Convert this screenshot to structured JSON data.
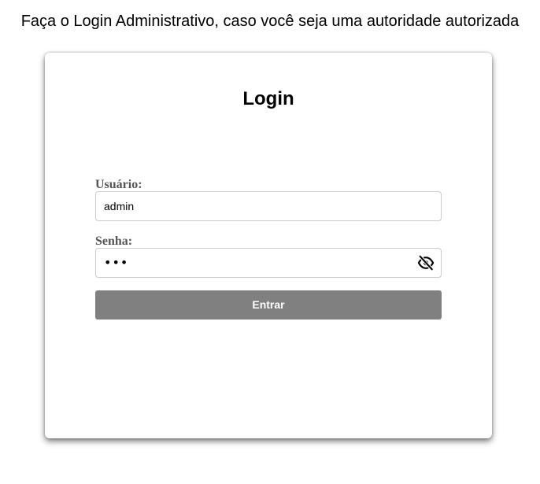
{
  "header": {
    "heading": "Faça o Login Administrativo, caso você seja uma autoridade autorizada"
  },
  "login_card": {
    "title": "Login",
    "username": {
      "label": "Usuário:",
      "value": "admin"
    },
    "password": {
      "label": "Senha:",
      "masked_value": "•••",
      "toggle_icon": "eye-slash-icon"
    },
    "submit_label": "Entrar"
  },
  "colors": {
    "button_bg": "#808080",
    "button_text": "#ffffff",
    "label_text": "#555555",
    "input_border": "#cccccc"
  }
}
